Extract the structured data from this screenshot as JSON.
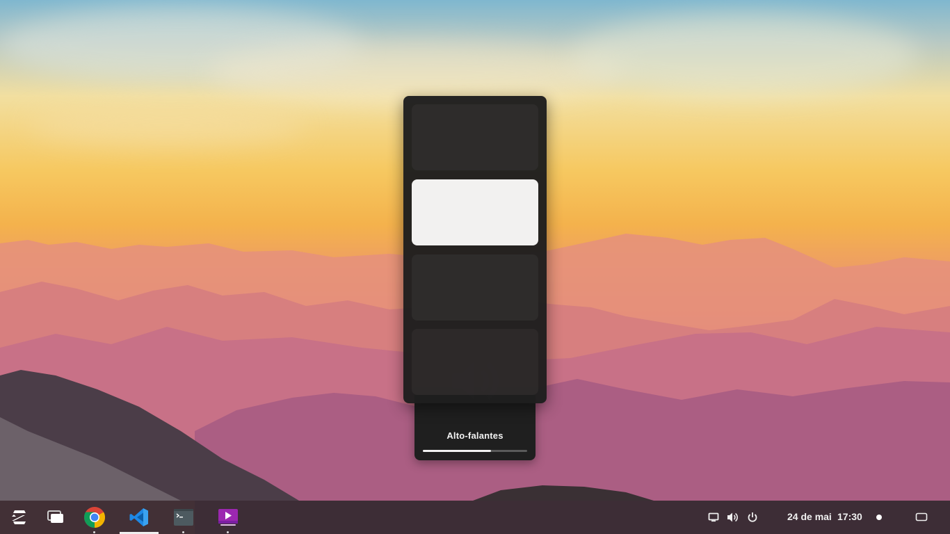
{
  "osd": {
    "device_label": "Alto-falantes",
    "volume_percent": 65
  },
  "switcher": {
    "items": [
      {
        "state": "inactive"
      },
      {
        "state": "active"
      },
      {
        "state": "inactive"
      },
      {
        "state": "inactive"
      }
    ]
  },
  "taskbar": {
    "apps": [
      {
        "name": "zorin-menu-icon",
        "running": false,
        "active": false
      },
      {
        "name": "files-icon",
        "running": false,
        "active": false
      },
      {
        "name": "chrome-icon",
        "running": true,
        "active": false
      },
      {
        "name": "vscode-icon",
        "running": true,
        "active": true
      },
      {
        "name": "terminal-icon",
        "running": true,
        "active": false
      },
      {
        "name": "video-player-icon",
        "running": true,
        "active": false
      }
    ],
    "tray": {
      "date": "24 de mai",
      "time": "17:30"
    }
  },
  "colors": {
    "osd_background": "#1f1f1f",
    "switcher_active": "#f2f1f0",
    "taskbar_background": "#242224"
  }
}
